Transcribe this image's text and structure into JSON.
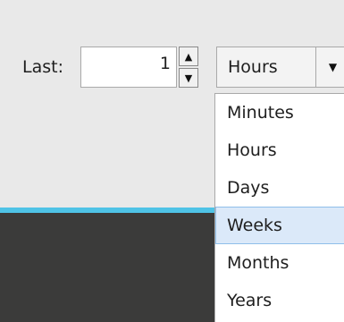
{
  "range": {
    "label": "Last:",
    "value": "1",
    "spin_up_icon": "triangle-up",
    "spin_down_icon": "triangle-down"
  },
  "unit_combo": {
    "selected": "Hours",
    "arrow_icon": "triangle-down",
    "options": [
      "Minutes",
      "Hours",
      "Days",
      "Weeks",
      "Months",
      "Years"
    ],
    "highlighted_option": "Weeks"
  },
  "colors": {
    "background": "#e9e9e9",
    "accent_line": "#4fc3e6",
    "dark_panel": "#3b3b3a",
    "highlight": "#dbe9f9"
  }
}
